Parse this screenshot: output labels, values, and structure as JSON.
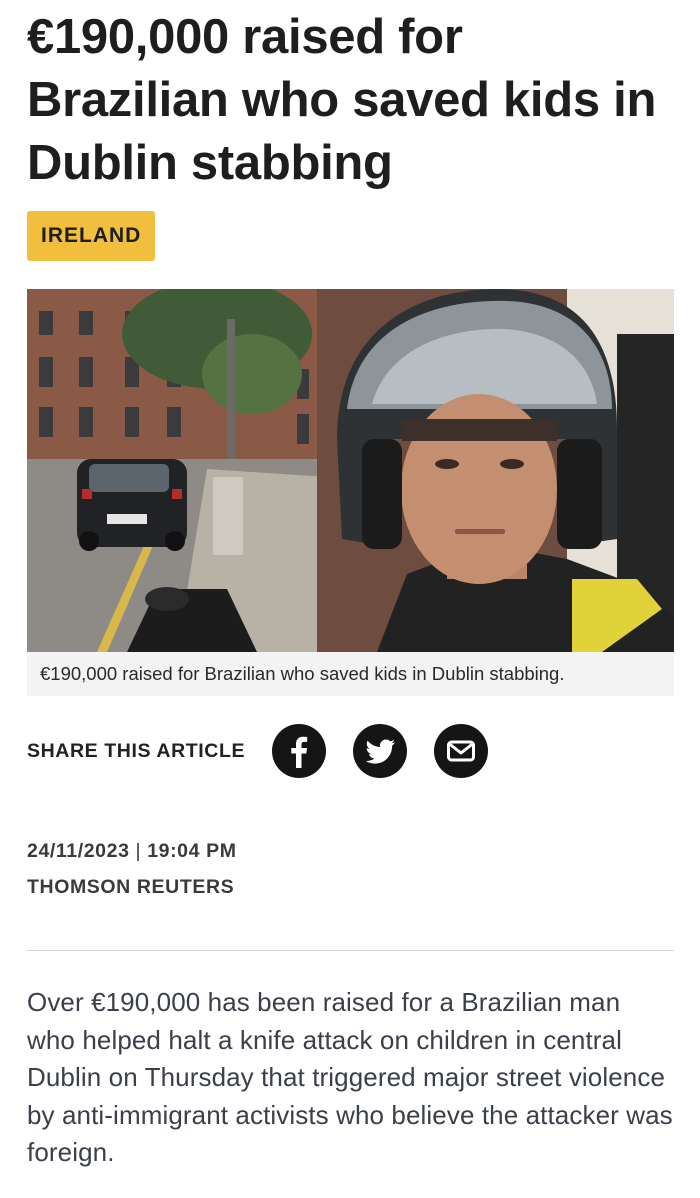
{
  "article": {
    "headline": "€190,000 raised for Brazilian who saved kids in Dublin stabbing",
    "category": "IRELAND",
    "image": {
      "caption": "€190,000 raised for Brazilian who saved kids in Dublin stabbing."
    },
    "share": {
      "label": "SHARE THIS ARTICLE",
      "buttons": [
        {
          "icon": "facebook-icon"
        },
        {
          "icon": "twitter-icon"
        },
        {
          "icon": "email-icon"
        }
      ]
    },
    "meta": {
      "date": "24/11/2023",
      "separator": "|",
      "time": "19:04 PM",
      "source": "THOMSON REUTERS"
    },
    "body": "Over €190,000 has been raised for a Brazilian man who helped halt a knife attack on children in central Dublin on Thursday that triggered major street violence by anti-immigrant activists who believe the attacker was foreign."
  },
  "colors": {
    "badge": "#f2be3e",
    "share_button": "#151515",
    "caption_bg": "#f3f3f3",
    "body_text": "#3b3f4a"
  }
}
